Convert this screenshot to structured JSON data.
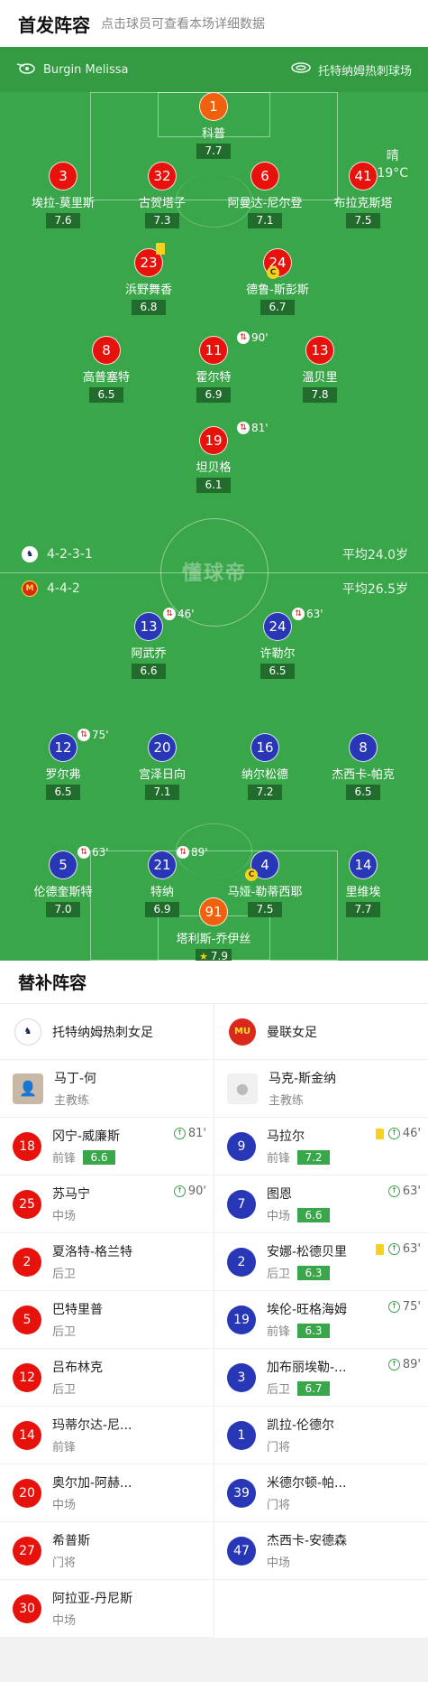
{
  "header": {
    "title": "首发阵容",
    "subtitle": "点击球员可查看本场详细数据"
  },
  "match_info": {
    "referee": "Burgin Melissa",
    "venue": "托特纳姆热刺球场",
    "weather": "晴",
    "temperature": "19°C",
    "watermark": "懂球帝"
  },
  "home": {
    "formation": "4-2-3-1",
    "avg_age": "平均24.0岁",
    "color": "#e8120c",
    "players": [
      {
        "number": "1",
        "name": "科普",
        "rating": "7.7"
      },
      {
        "number": "3",
        "name": "埃拉-莫里斯",
        "rating": "7.6"
      },
      {
        "number": "32",
        "name": "古贺塔子",
        "rating": "7.3"
      },
      {
        "number": "6",
        "name": "阿曼达-尼尔登",
        "rating": "7.1"
      },
      {
        "number": "41",
        "name": "布拉克斯塔",
        "rating": "7.5"
      },
      {
        "number": "23",
        "name": "浜野舞香",
        "rating": "6.8"
      },
      {
        "number": "24",
        "name": "德鲁-斯彭斯",
        "rating": "6.7"
      },
      {
        "number": "8",
        "name": "高普塞特",
        "rating": "6.5"
      },
      {
        "number": "11",
        "name": "霍尔特",
        "rating": "6.9",
        "sub_time": "90'"
      },
      {
        "number": "13",
        "name": "温贝里",
        "rating": "7.8"
      },
      {
        "number": "19",
        "name": "坦贝格",
        "rating": "6.1",
        "sub_time": "81'"
      }
    ]
  },
  "away": {
    "formation": "4-4-2",
    "avg_age": "平均26.5岁",
    "color": "#2737b5",
    "players": [
      {
        "number": "13",
        "name": "阿武乔",
        "rating": "6.6",
        "sub_time": "46'"
      },
      {
        "number": "24",
        "name": "许勒尔",
        "rating": "6.5",
        "sub_time": "63'"
      },
      {
        "number": "12",
        "name": "罗尔弗",
        "rating": "6.5",
        "sub_time": "75'"
      },
      {
        "number": "20",
        "name": "宫泽日向",
        "rating": "7.1"
      },
      {
        "number": "16",
        "name": "纳尔松德",
        "rating": "7.2"
      },
      {
        "number": "8",
        "name": "杰西卡-帕克",
        "rating": "6.5"
      },
      {
        "number": "5",
        "name": "伦德奎斯特",
        "rating": "7.0",
        "sub_time": "63'"
      },
      {
        "number": "21",
        "name": "特纳",
        "rating": "6.9",
        "sub_time": "89'"
      },
      {
        "number": "4",
        "name": "马娅-勒蒂西耶",
        "rating": "7.5"
      },
      {
        "number": "14",
        "name": "里维埃",
        "rating": "7.7"
      },
      {
        "number": "91",
        "name": "塔利斯-乔伊丝",
        "rating": "7.9"
      }
    ]
  },
  "bench": {
    "title": "替补阵容",
    "home": {
      "team_name": "托特纳姆热刺女足",
      "coach": {
        "name": "马丁-何",
        "role": "主教练"
      },
      "subs": [
        {
          "number": "18",
          "name": "冈宁-威廉斯",
          "pos": "前锋",
          "rating": "6.6",
          "in": "81'"
        },
        {
          "number": "25",
          "name": "苏马宁",
          "pos": "中场",
          "in": "90'"
        },
        {
          "number": "2",
          "name": "夏洛特-格兰特",
          "pos": "后卫"
        },
        {
          "number": "5",
          "name": "巴特里普",
          "pos": "后卫"
        },
        {
          "number": "12",
          "name": "吕布林克",
          "pos": "后卫"
        },
        {
          "number": "14",
          "name": "玛蒂尔达-尼...",
          "pos": "前锋"
        },
        {
          "number": "20",
          "name": "奥尔加-阿赫...",
          "pos": "中场"
        },
        {
          "number": "27",
          "name": "希普斯",
          "pos": "门将"
        },
        {
          "number": "30",
          "name": "阿拉亚-丹尼斯",
          "pos": "中场"
        }
      ]
    },
    "away": {
      "team_name": "曼联女足",
      "coach": {
        "name": "马克-斯金纳",
        "role": "主教练"
      },
      "subs": [
        {
          "number": "9",
          "name": "马拉尔",
          "pos": "前锋",
          "rating": "7.2",
          "in": "46'"
        },
        {
          "number": "7",
          "name": "图恩",
          "pos": "中场",
          "rating": "6.6",
          "in": "63'"
        },
        {
          "number": "2",
          "name": "安娜-松德贝里",
          "pos": "后卫",
          "rating": "6.3",
          "in": "63'"
        },
        {
          "number": "19",
          "name": "埃伦-旺格海姆",
          "pos": "前锋",
          "rating": "6.3",
          "in": "75'"
        },
        {
          "number": "3",
          "name": "加布丽埃勒-...",
          "pos": "后卫",
          "rating": "6.7",
          "in": "89'"
        },
        {
          "number": "1",
          "name": "凯拉-伦德尔",
          "pos": "门将"
        },
        {
          "number": "39",
          "name": "米德尔顿-帕...",
          "pos": "门将"
        },
        {
          "number": "47",
          "name": "杰西卡-安德森",
          "pos": "中场"
        }
      ]
    }
  }
}
